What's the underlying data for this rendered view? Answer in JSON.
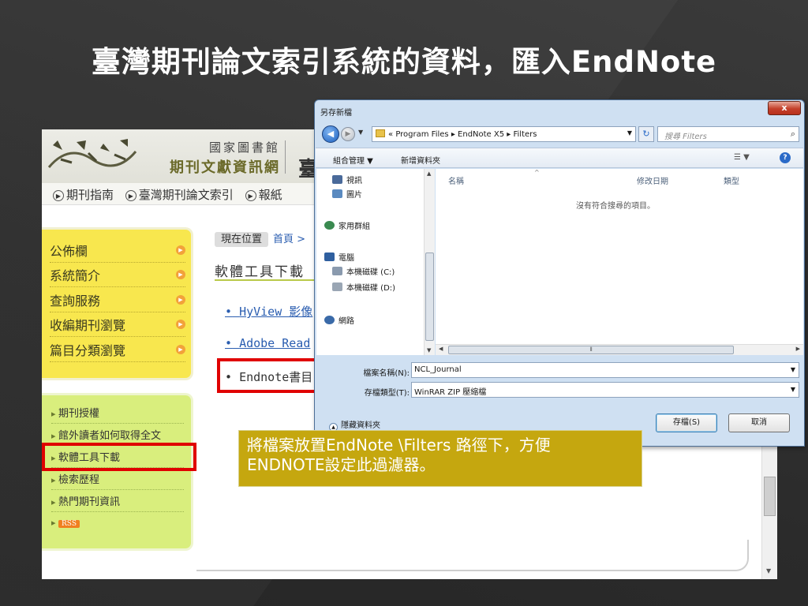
{
  "slide": {
    "title": "臺灣期刊論文索引系統的資料，匯入EndNote"
  },
  "web": {
    "header": {
      "library": "國家圖書館",
      "network": "期刊文獻資訊網",
      "big_char": "臺"
    },
    "nav": [
      "期刊指南",
      "臺灣期刊論文索引",
      "報紙"
    ],
    "yellow_menu": [
      "公佈欄",
      "系統簡介",
      "查詢服務",
      "收編期刊瀏覽",
      "篇目分類瀏覽"
    ],
    "green_menu": [
      "期刊授權",
      "館外讀者如何取得全文",
      "軟體工具下載",
      "檢索歷程",
      "熱門期刊資訊"
    ],
    "rss": "RSS",
    "breadcrumb": {
      "here": "現在位置",
      "home": "首頁 >"
    },
    "content_title": "軟體工具下載",
    "links": [
      "HyView 影像",
      "Adobe Read",
      "Endnote書目"
    ],
    "bullet": "•"
  },
  "dialog": {
    "title": "另存新檔",
    "close": "x",
    "address": {
      "prefix": "«",
      "path": [
        "Program Files",
        "EndNote X5",
        "Filters"
      ]
    },
    "search_placeholder": "搜尋 Filters",
    "toolbar": {
      "organize": "組合管理 ▼",
      "new_folder": "新增資料夾"
    },
    "nav_items": [
      "視訊",
      "圖片",
      "家用群組",
      "電腦",
      "本機磁碟 (C:)",
      "本機磁碟 (D:)",
      "網路"
    ],
    "columns": {
      "name": "名稱",
      "date": "修改日期",
      "type": "類型"
    },
    "empty_message": "沒有符合搜尋的項目。",
    "filename_label": "檔案名稱(N):",
    "filename_value": "NCL_Journal",
    "filetype_label": "存檔類型(T):",
    "filetype_value": "WinRAR ZIP 壓縮檔",
    "hide_folders": "隱藏資料夾",
    "save_button": "存檔(S)",
    "cancel_button": "取消"
  },
  "callout": {
    "line1": "將檔案放置EndNote \\Filters 路徑下，方便",
    "line2": "ENDNOTE設定此過濾器。"
  },
  "colors": {
    "slide_bg": "#2f2f2f",
    "highlight_red": "#e00000",
    "callout_bg": "#c5a70f",
    "menu_yellow": "#f8e74e",
    "menu_green": "#d9ee7d"
  }
}
